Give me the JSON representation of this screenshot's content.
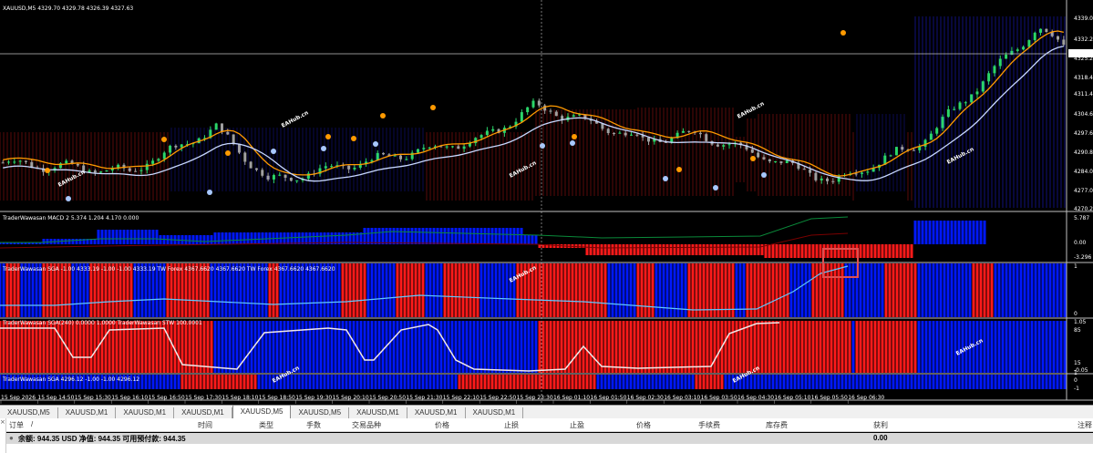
{
  "main_chart": {
    "header": "XAUUSD,M5  4329.70 4329.78 4326.39 4327.63",
    "price_ticks": [
      "4339.00",
      "4332.20",
      "4327.63",
      "4325.20",
      "4318.40",
      "4311.40",
      "4304.60",
      "4297.60",
      "4290.80",
      "4284.00",
      "4277.00",
      "4270.20"
    ],
    "current_price": "4327.63"
  },
  "macd_panel": {
    "header": "TraderWawasan MACD 2 5.374 1.204 4.170 0.000",
    "ticks": [
      "5.787",
      "0.00",
      "-3.296"
    ]
  },
  "sga_panel": {
    "header": "TraderWawasan SGA -1.00 4333.19 -1.00 -1.00 4333.19  TW Forex 4367.6620 4367.6620  TW Forex 4367.6620 4367.6620",
    "ticks": [
      "1",
      "0"
    ]
  },
  "stoch_panel": {
    "header": "TraderWawasan SGA(240) 0.0000 1.0000  TraderWawasan STW 100.0001",
    "ticks": [
      "1.05",
      "85",
      "15",
      "-0.05"
    ]
  },
  "sga2_panel": {
    "header": "TraderWawasan SGA 4296.12 -1.00 -1.00 4296.12",
    "ticks": [
      "1",
      "0",
      "-1"
    ]
  },
  "time_axis": [
    "15 Sep 2026",
    "15 Sep 14:50",
    "15 Sep 15:30",
    "15 Sep 16:10",
    "15 Sep 16:50",
    "15 Sep 17:30",
    "15 Sep 18:10",
    "15 Sep 18:50",
    "15 Sep 19:30",
    "15 Sep 20:10",
    "15 Sep 20:50",
    "15 Sep 21:30",
    "15 Sep 22:10",
    "15 Sep 22:50",
    "15 Sep 23:30",
    "16 Sep 01:10",
    "16 Sep 01:50",
    "16 Sep 02:30",
    "16 Sep 03:10",
    "16 Sep 03:50",
    "16 Sep 04:30",
    "16 Sep 05:10",
    "16 Sep 05:50",
    "16 Sep 06:30"
  ],
  "watermark": "EAHub.cn",
  "tabs": [
    "XAUUSD,M5",
    "XAUUSD,M1",
    "XAUUSD,M1",
    "XAUUSD,M1",
    "XAUUSD,M5",
    "XAUUSD,M5",
    "XAUUSD,M1",
    "XAUUSD,M1",
    "XAUUSD,M1"
  ],
  "active_tab_index": 4,
  "table_headers": {
    "order": "订单",
    "sort": "/",
    "time": "时间",
    "type": "类型",
    "lots": "手数",
    "symbol": "交易品种",
    "price": "价格",
    "sl": "止损",
    "tp": "止盈",
    "price2": "价格",
    "commission": "手续费",
    "swap": "库存费",
    "profit": "获利",
    "comment": "注释"
  },
  "balance_row": {
    "text": "余额: 944.35 USD  净值: 944.35  可用预付款: 944.35",
    "profit": "0.00"
  },
  "colors": {
    "bull": "#2bd66a",
    "bear": "#a0a0a0",
    "blue": "#0018ff",
    "red": "#ff1a1a",
    "orange": "#ff9a00",
    "line": "#c8d8ff"
  }
}
